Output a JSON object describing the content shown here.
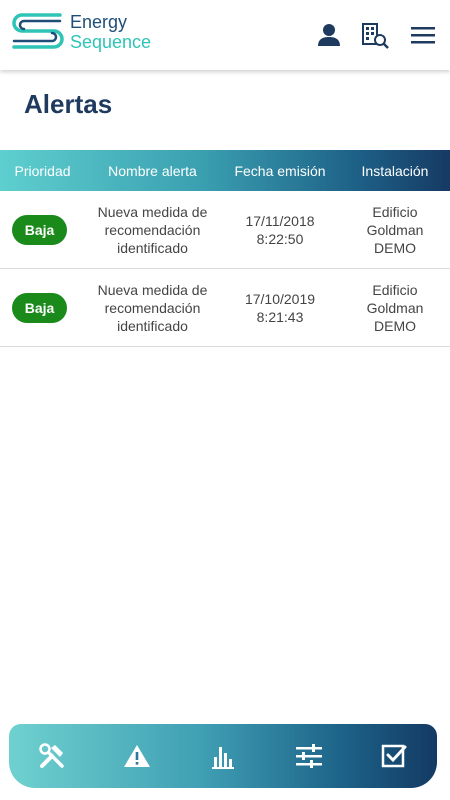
{
  "brand": {
    "line1": "Energy",
    "line2": "Sequence"
  },
  "header_icons": [
    "user-icon",
    "building-search-icon",
    "menu-icon"
  ],
  "page": {
    "title": "Alertas"
  },
  "table": {
    "headers": [
      "Prioridad",
      "Nombre alerta",
      "Fecha emisión",
      "Instalación"
    ],
    "rows": [
      {
        "priority": "Baja",
        "name_lines": [
          "Nueva medida de",
          "recomendación",
          "identificado"
        ],
        "date": "17/11/2018",
        "time": "8:22:50",
        "installation_lines": [
          "Edificio",
          "Goldman",
          "DEMO"
        ]
      },
      {
        "priority": "Baja",
        "name_lines": [
          "Nueva medida de",
          "recomendación",
          "identificado"
        ],
        "date": "17/10/2019",
        "time": "8:21:43",
        "installation_lines": [
          "Edificio",
          "Goldman",
          "DEMO"
        ]
      }
    ]
  },
  "bottom_nav": [
    "tools-icon",
    "alert-icon",
    "chart-icon",
    "settings-sliders-icon",
    "checkbox-icon"
  ],
  "colors": {
    "primary": "#1f3a5f",
    "accent": "#2ec4b6",
    "badge_low": "#1a8a1a"
  }
}
